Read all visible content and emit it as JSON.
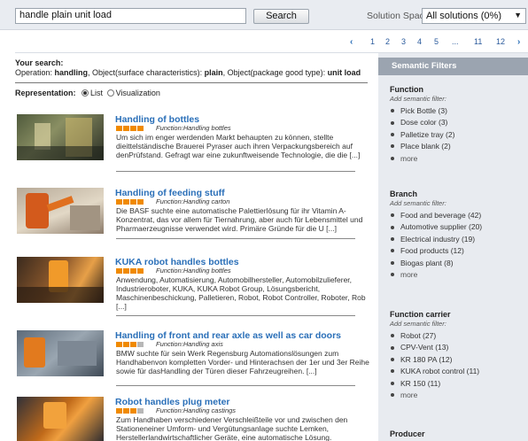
{
  "search": {
    "query": "handle plain unit load",
    "button": "Search"
  },
  "solution_space": {
    "label": "Solution Space:",
    "value": "All solutions (0%)"
  },
  "pagination": {
    "prev": "‹",
    "pages": [
      "1",
      "2",
      "3",
      "4",
      "5",
      "...",
      "11",
      "12"
    ],
    "next": "›",
    "current": "1"
  },
  "your_search": {
    "heading": "Your search:",
    "line_prefix": "Operation: ",
    "operation": "handling",
    "mid1": ", Object(surface characteristics): ",
    "surface": "plain",
    "mid2": ", Object(package good type): ",
    "package": "unit load"
  },
  "representation": {
    "label": "Representation:",
    "list": "List",
    "visualization": "Visualization"
  },
  "results": [
    {
      "title": "Handling of bottles",
      "function": "Function:Handling bottles",
      "rating": 4,
      "desc": "Um sich im enger werdenden Markt behaupten zu können, stellte dieittelständische Brauerei Pyraser auch ihren Verpackungsbereich auf denPrüfstand. Gefragt war eine zukunftweisende Technologie, die die [...]"
    },
    {
      "title": "Handling of feeding stuff",
      "function": "Function:Handling carton",
      "rating": 4,
      "desc": "Die BASF suchte eine automatische Palettierlösung für ihr Vitamin A-Konzentrat, das vor allem für Tiernahrung, aber auch für Lebensmittel und Pharmaerzeugnisse verwendet wird. Primäre Gründe für die U [...]"
    },
    {
      "title": "KUKA robot handles bottles",
      "function": "Function:Handling bottles",
      "rating": 4,
      "desc": "Anwendung, Automatisierung, Automobilhersteller, Automobilzulieferer, Industrieroboter, KUKA, KUKA Robot Group, Lösungsbericht, Maschinenbeschickung, Palletieren, Robot, Robot Controller, Roboter, Rob [...]"
    },
    {
      "title": "Handling of front and rear axle as well as car doors",
      "function": "Function:Handling axis",
      "rating": 3,
      "desc": "BMW suchte für sein Werk Regensburg Automationslösungen zum Handhabenvon kompletten Vorder- und Hinterachsen der 1er und 3er Reihe sowie für dasHandling der Türen dieser Fahrzeugreihen. [...]"
    },
    {
      "title": "Robot handles plug meter",
      "function": "Function:Handling castings",
      "rating": 3,
      "desc": "Zum Handhaben verschiedener Verschleißteile vor und zwischen den Stationeneiner Umform- und Vergütungsanlage suchte Lemken, Herstellerlandwirtschaftlicher Geräte, eine automatische Lösung."
    }
  ],
  "semantic_filters": {
    "header": "Semantic Filters",
    "add_label": "Add semantic filter:",
    "groups": [
      {
        "title": "Function",
        "items": [
          "Pick Bottle (3)",
          "Dose color (3)",
          "Palletize tray (2)",
          "Place blank (2)",
          "more"
        ]
      },
      {
        "title": "Branch",
        "items": [
          "Food and beverage (42)",
          "Automotive supplier (20)",
          "Electrical industry (19)",
          "Food products (12)",
          "Biogas plant (8)",
          "more"
        ]
      },
      {
        "title": "Function carrier",
        "items": [
          "Robot (27)",
          "CPV-Vent (13)",
          "KR 180 PA (12)",
          "KUKA robot control (11)",
          "KR 150 (11)",
          "more"
        ]
      },
      {
        "title": "Producer",
        "items": []
      }
    ]
  },
  "colors": {
    "link": "#2a6fb8",
    "rating_on": "#f08a00",
    "rating_off": "#b7b7b7",
    "filter_header": "#9ba4b0"
  }
}
